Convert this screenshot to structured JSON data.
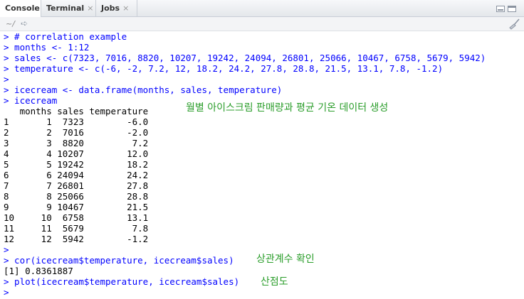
{
  "tabs": [
    {
      "label": "Console",
      "closable": false,
      "active": true
    },
    {
      "label": "Terminal",
      "closable": true,
      "active": false
    },
    {
      "label": "Jobs",
      "closable": true,
      "active": false
    }
  ],
  "tab_close_glyph": "×",
  "path": "~/",
  "icons": {
    "path_arrow": "navigate-arrow-icon",
    "clear": "broom-icon"
  },
  "colors": {
    "command": "#0000ff",
    "output": "#000000",
    "annotation": "#2a9d2a"
  },
  "console": {
    "prompt": ">",
    "lines": [
      {
        "kind": "cmd",
        "text": "> # correlation example"
      },
      {
        "kind": "cmd",
        "text": "> months <- 1:12"
      },
      {
        "kind": "cmd",
        "text": "> sales <- c(7323, 7016, 8820, 10207, 19242, 24094, 26801, 25066, 10467, 6758, 5679, 5942)"
      },
      {
        "kind": "cmd",
        "text": "> temperature <- c(-6, -2, 7.2, 12, 18.2, 24.2, 27.8, 28.8, 21.5, 13.1, 7.8, -1.2)"
      },
      {
        "kind": "cmd",
        "text": ">"
      },
      {
        "kind": "cmd",
        "text": "> icecream <- data.frame(months, sales, temperature)"
      },
      {
        "kind": "cmd",
        "text": "> icecream"
      },
      {
        "kind": "out",
        "text": "   months sales temperature"
      },
      {
        "kind": "out",
        "text": "1       1  7323        -6.0"
      },
      {
        "kind": "out",
        "text": "2       2  7016        -2.0"
      },
      {
        "kind": "out",
        "text": "3       3  8820         7.2"
      },
      {
        "kind": "out",
        "text": "4       4 10207        12.0"
      },
      {
        "kind": "out",
        "text": "5       5 19242        18.2"
      },
      {
        "kind": "out",
        "text": "6       6 24094        24.2"
      },
      {
        "kind": "out",
        "text": "7       7 26801        27.8"
      },
      {
        "kind": "out",
        "text": "8       8 25066        28.8"
      },
      {
        "kind": "out",
        "text": "9       9 10467        21.5"
      },
      {
        "kind": "out",
        "text": "10     10  6758        13.1"
      },
      {
        "kind": "out",
        "text": "11     11  5679         7.8"
      },
      {
        "kind": "out",
        "text": "12     12  5942        -1.2"
      },
      {
        "kind": "cmd",
        "text": ">"
      },
      {
        "kind": "cmd",
        "text": "> cor(icecream$temperature, icecream$sales)"
      },
      {
        "kind": "out",
        "text": "[1] 0.8361887"
      },
      {
        "kind": "cmd",
        "text": "> plot(icecream$temperature, icecream$sales)"
      },
      {
        "kind": "cmd",
        "text": ">"
      }
    ],
    "annotations": {
      "table_note": "월별 아이스크림 판매량과 평균 기온 데이터 생성",
      "cor_note": "상관계수 확인",
      "plot_note": "산점도"
    }
  }
}
